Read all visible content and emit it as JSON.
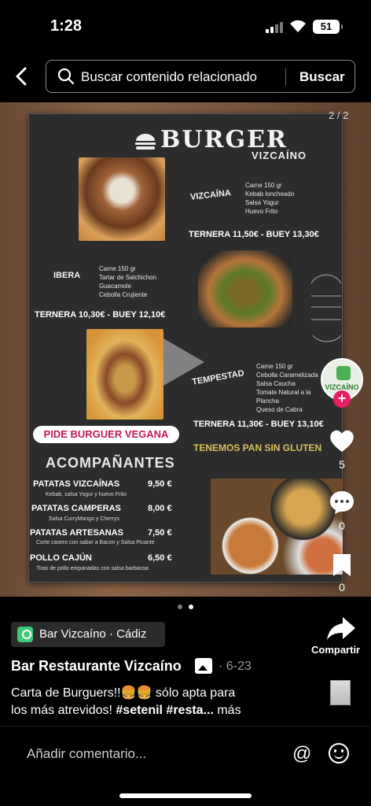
{
  "status": {
    "time": "1:28",
    "battery": "51"
  },
  "header": {
    "search_placeholder": "Buscar contenido relacionado",
    "search_button": "Buscar"
  },
  "photo": {
    "pager": "2 / 2",
    "menu": {
      "title": "BURGER",
      "subtitle": "VIZCAÍNO",
      "items": [
        {
          "name": "VIZCAÍNA",
          "ingredients": [
            "Carne 150 gr",
            "Kebab loncheado",
            "Salsa Yogur",
            "Huevo Frito"
          ],
          "price": "TERNERA 11,50€ - BUEY 13,30€"
        },
        {
          "name": "IBERA",
          "ingredients": [
            "Carne 150 gr",
            "Tartar de Salchichon",
            "Guacamole",
            "Cebolla Crujiente"
          ],
          "price": "TERNERA 10,30€ - BUEY 12,10€"
        },
        {
          "name": "TEMPESTAD",
          "ingredients": [
            "Carne 150 gr",
            "Cebolla Caramelizada",
            "Salsa Caucha",
            "Tomate Natural a la Plancha",
            "Queso de Cabra"
          ],
          "price": "TERNERA 11,30€ - BUEY 13,10€"
        }
      ],
      "vegan": "PIDE BURGUER VEGANA",
      "gluten": "TENEMOS PAN SIN GLUTEN",
      "sides_title": "ACOMPAÑANTES",
      "sides": [
        {
          "name": "PATATAS VIZCAÍNAS",
          "price": "9,50 €",
          "desc": "Kebab, salsa Yogur y huevo Frito"
        },
        {
          "name": "PATATAS CAMPERAS",
          "price": "8,00 €",
          "desc": "Salsa CurryMango y Cherrys"
        },
        {
          "name": "PATATAS ARTESANAS",
          "price": "7,50 €",
          "desc": "Corte casero con sabor a Bacon y Salsa Picante"
        },
        {
          "name": "POLLO CAJÚN",
          "price": "6,50 €",
          "desc": "Tiras de pollo empanadas con salsa barbacoa"
        }
      ]
    }
  },
  "actions": {
    "avatar_label": "VIZCAÍNO",
    "likes": "5",
    "comments": "0",
    "saves": "0",
    "share": "Compartir"
  },
  "post": {
    "location": "Bar Vizcaíno · Cádiz",
    "author": "Bar Restaurante Vizcaíno",
    "date": "· 6-23",
    "caption_line1": "Carta de Burguers!!🍔🍔 sólo apta para",
    "caption_line2_text": "los más atrevidos! ",
    "caption_tags": "#setenil #resta...",
    "caption_more": " más"
  },
  "comment_bar": {
    "placeholder": "Añadir comentario...",
    "at": "@"
  },
  "colors": {
    "accent": "#e91e63",
    "location_pin": "#3ec97a",
    "vegan_text": "#c2185b"
  }
}
